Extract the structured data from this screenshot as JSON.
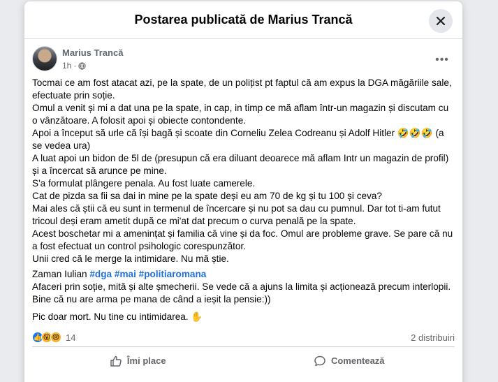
{
  "dialog": {
    "title": "Postarea publicată de Marius Trancă",
    "close_icon": "close-icon"
  },
  "post": {
    "author": "Marius Trancă",
    "time": "1h",
    "privacy_icon": "globe-icon",
    "more_icon": "more-dots-icon",
    "paragraphs": [
      "Tocmai ce am fost atacat azi, pe la spate, de un polițist pt faptul că am expus la DGA măgăriile sale, efectuate prin soție.",
      "Omul a venit și mi a dat una pe la spate, in cap, in timp ce mă aflam într-un magazin și discutam cu o vânzătoare. A folosit apoi și obiecte contondente.",
      "Apoi a început să urle că își bagă și scoate din Corneliu Zelea Codreanu și Adolf Hitler 🤣🤣🤣 (a se vedea ura)",
      "A luat apoi un bidon de 5l de (presupun că era diluant deoarece mă aflam Intr un magazin de profil) și a încercat să arunce pe mine.",
      "S'a formulat plângere penala. Au fost luate camerele.",
      "Cat de pizda sa fii sa dai in mine pe la spate deși eu am 70 de kg și tu 100 și ceva?",
      "Mai ales că știi că eu sunt in termenul de încercare și nu pot sa dau cu pumnul. Dar tot ti-am futut tricoul deși eram ametit după ce mi'at dat precum o curva penală pe la spate.",
      "Acest boschetar mi a amenințat și familia că vine și da foc. Omul are probleme grave. Se pare că nu a fost efectuat un control psihologic corespunzător.",
      "Unii cred că le merge la intimidare. Nu mă știe."
    ],
    "signature_name": "Zaman Iulian",
    "hashtags": [
      "#dga",
      "#mai",
      "#politiaromana"
    ],
    "closing_paragraphs": [
      "Afaceri prin soție, mită și alte șmecherii. Se vede că a ajuns la limita și acționează precum interlopii.",
      "Bine că nu are arma pe mana de când a ieșit la pensie:))"
    ],
    "final_line": "Pic doar mort. Nu tine cu intimidarea. ✋"
  },
  "reactions": {
    "icons": [
      "like",
      "wow",
      "sad"
    ],
    "count": "14",
    "shares": "2 distribuiri"
  },
  "actions": {
    "like_label": "Îmi place",
    "comment_label": "Comentează"
  },
  "colors": {
    "hashtag": "#216fdb",
    "like_blue": "#1877f2",
    "muted": "#65676b"
  }
}
